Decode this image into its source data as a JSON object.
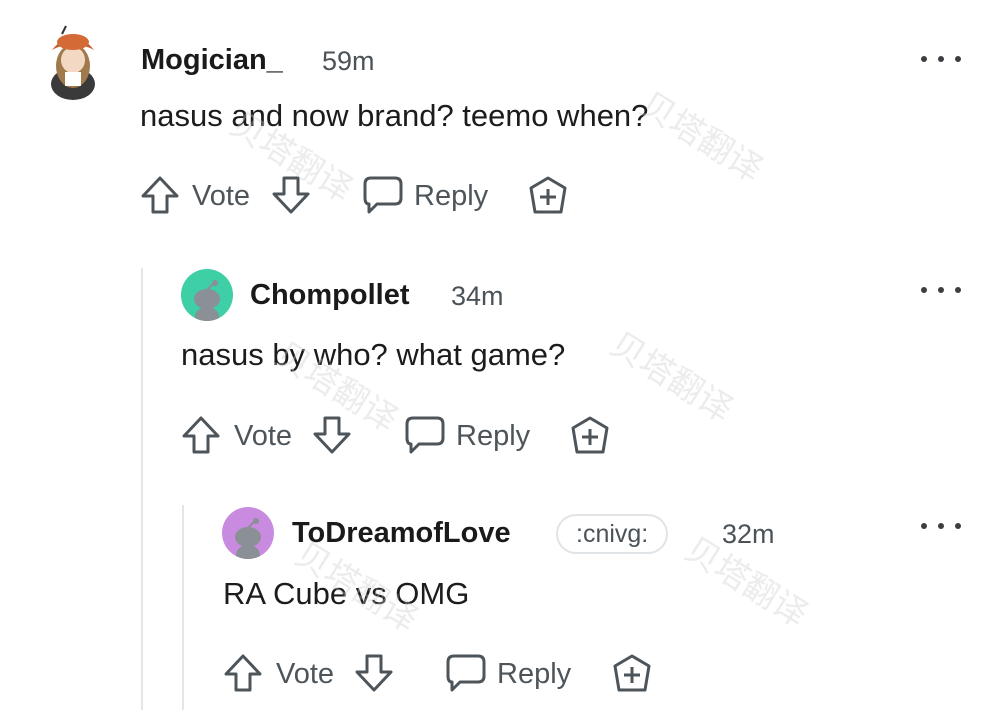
{
  "comments": [
    {
      "username": "Mogician_",
      "time": "59m",
      "text": "nasus and now brand? teemo when?",
      "vote_label": "Vote",
      "reply_label": "Reply"
    },
    {
      "username": "Chompollet",
      "time": "34m",
      "text": "nasus by who? what game?",
      "vote_label": "Vote",
      "reply_label": "Reply",
      "avatar_color": "#3ecfa7"
    },
    {
      "username": "ToDreamofLove",
      "flair": ":cnivg:",
      "time": "32m",
      "text": "RA Cube vs OMG",
      "vote_label": "Vote",
      "reply_label": "Reply",
      "avatar_color": "#c98be0"
    }
  ],
  "watermark": "贝塔翻译",
  "colors": {
    "text": "#1c1c1c",
    "meta": "#4b5358",
    "thread_line": "#e3e6e8"
  }
}
